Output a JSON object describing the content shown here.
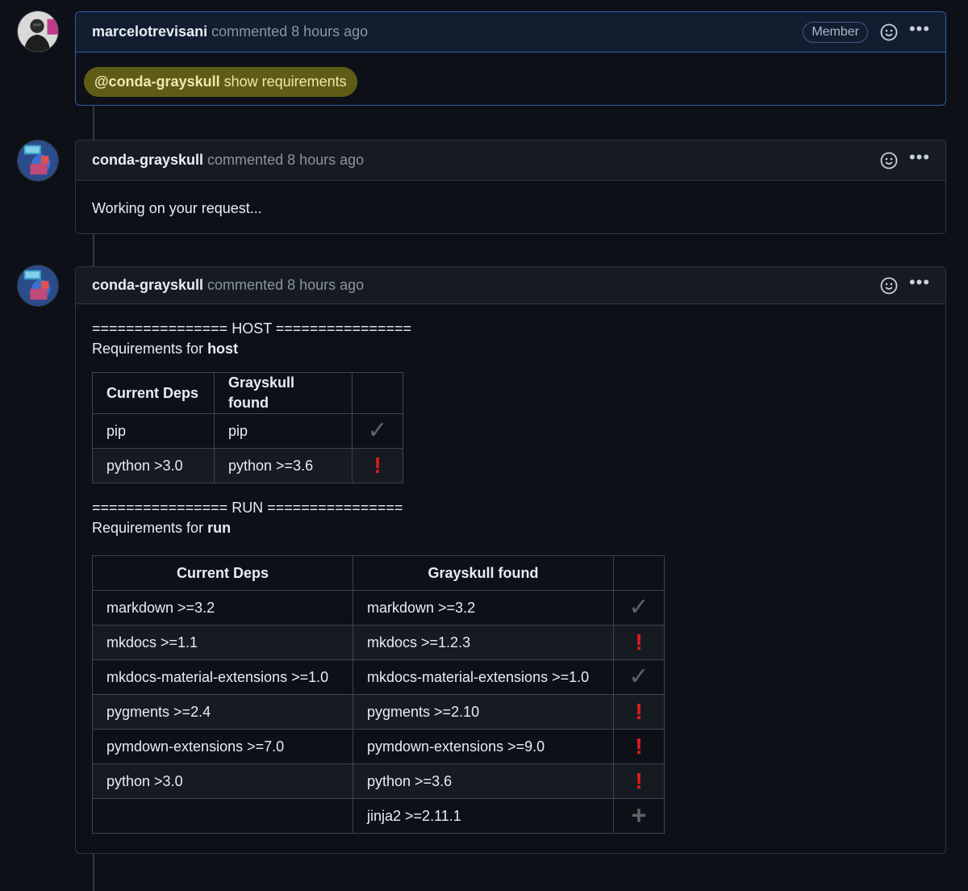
{
  "comments": [
    {
      "author": "marcelotrevisani",
      "action": "commented 8 hours ago",
      "badge": "Member",
      "mention": "@conda-grayskull",
      "mention_rest": " show requirements"
    },
    {
      "author": "conda-grayskull",
      "action": "commented 8 hours ago",
      "body": "Working on your request..."
    },
    {
      "author": "conda-grayskull",
      "action": "commented 8 hours ago",
      "host": {
        "separator": "================ HOST ================",
        "label_prefix": "Requirements for ",
        "label_bold": "host",
        "headers": [
          "Current Deps",
          "Grayskull found",
          ""
        ],
        "rows": [
          {
            "current": "pip",
            "found": "pip",
            "status": "check"
          },
          {
            "current": "python >3.0",
            "found": "python >=3.6",
            "status": "bang"
          }
        ]
      },
      "run": {
        "separator": "================ RUN ================",
        "label_prefix": "Requirements for ",
        "label_bold": "run",
        "headers": [
          "Current Deps",
          "Grayskull found",
          ""
        ],
        "rows": [
          {
            "current": "markdown >=3.2",
            "found": "markdown >=3.2",
            "status": "check"
          },
          {
            "current": "mkdocs >=1.1",
            "found": "mkdocs >=1.2.3",
            "status": "bang"
          },
          {
            "current": "mkdocs-material-extensions >=1.0",
            "found": "mkdocs-material-extensions >=1.0",
            "status": "check"
          },
          {
            "current": "pygments >=2.4",
            "found": "pygments >=2.10",
            "status": "bang"
          },
          {
            "current": "pymdown-extensions >=7.0",
            "found": "pymdown-extensions >=9.0",
            "status": "bang"
          },
          {
            "current": "python >3.0",
            "found": "python >=3.6",
            "status": "bang"
          },
          {
            "current": "",
            "found": "jinja2 >=2.11.1",
            "status": "plus"
          }
        ]
      }
    }
  ],
  "status_glyphs": {
    "check": "✓",
    "bang": "!",
    "plus": "+"
  },
  "colors": {
    "background": "#0d1117",
    "border": "#30363d",
    "error": "#e01b1b",
    "highlight": "#5f5c16"
  }
}
